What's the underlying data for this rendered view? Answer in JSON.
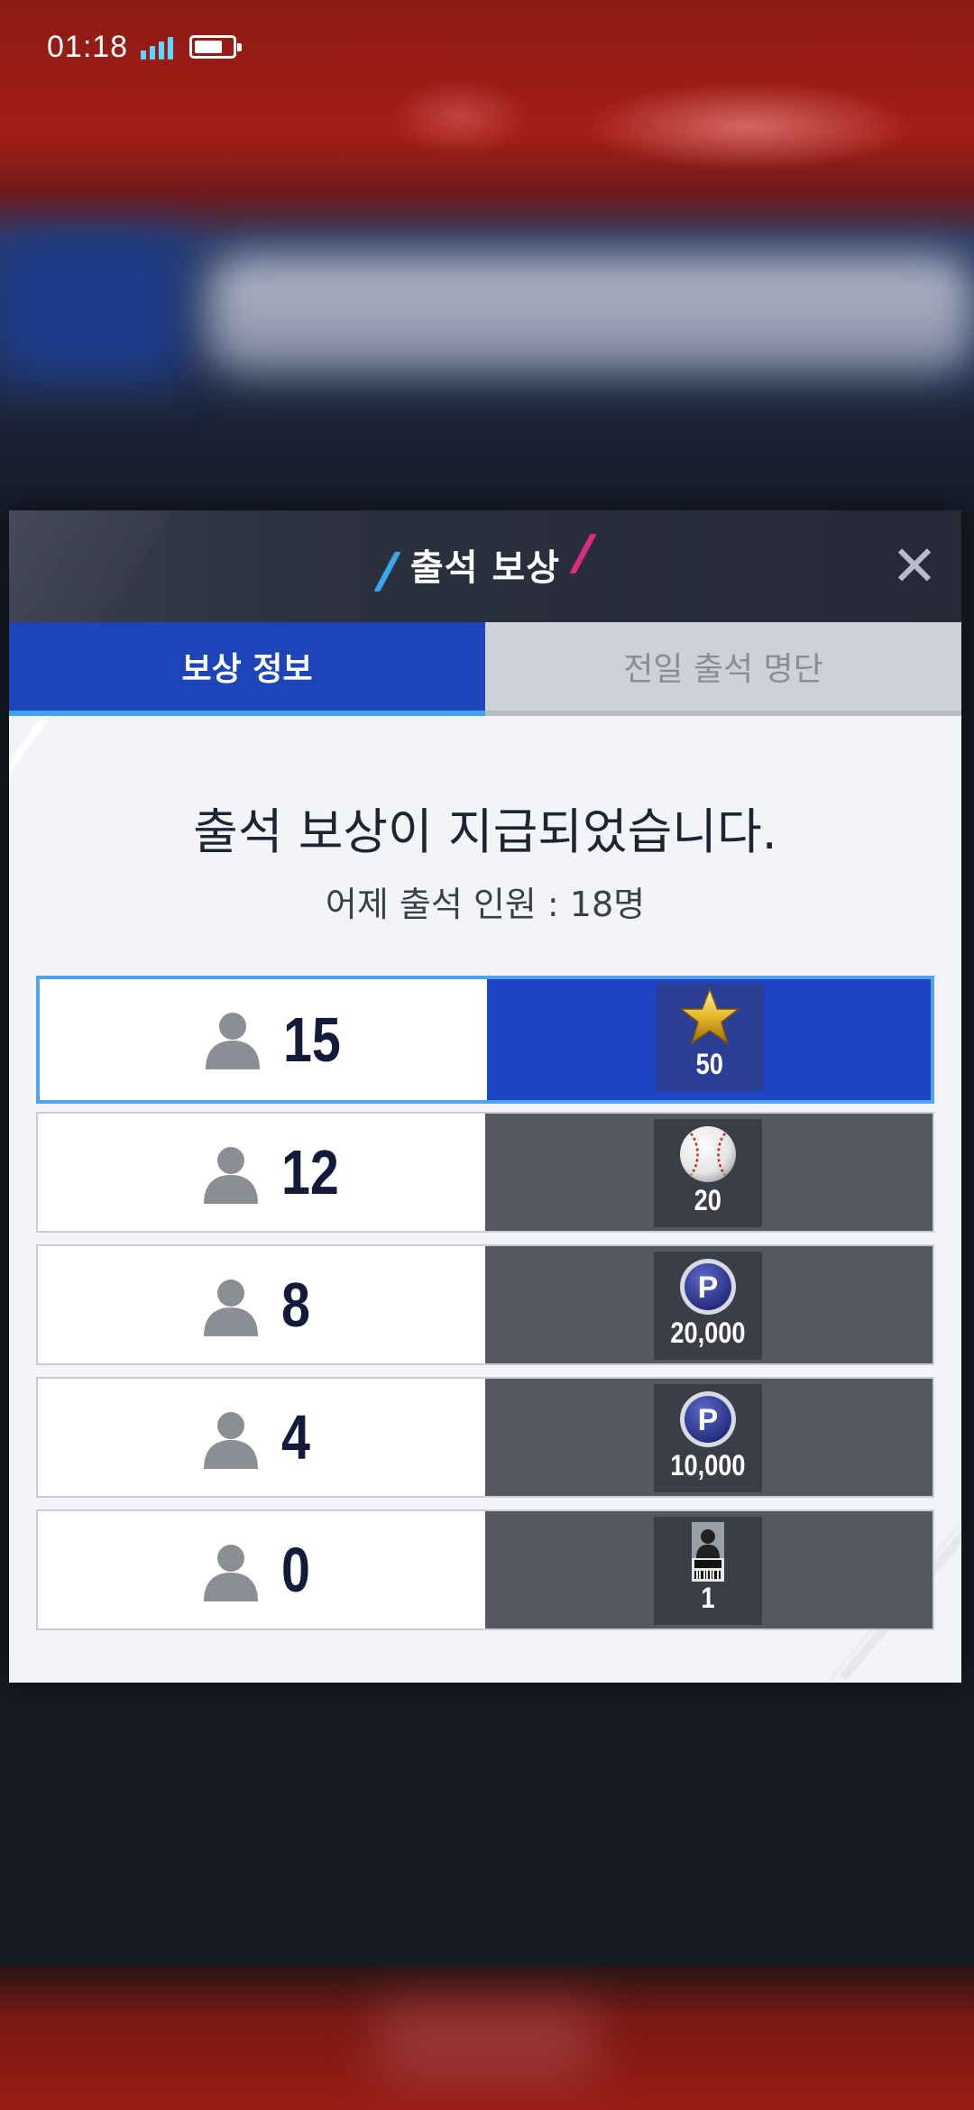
{
  "status_bar": {
    "time": "01:18"
  },
  "modal": {
    "title": "출석 보상",
    "close_icon": "close-icon",
    "tabs": [
      {
        "label": "보상 정보",
        "active": true
      },
      {
        "label": "전일 출석 명단",
        "active": false
      }
    ],
    "headline": "출석 보상이 지급되었습니다.",
    "subline": "어제 출석 인원 : 18명",
    "rewards": [
      {
        "count": "15",
        "icon": "star-icon",
        "amount": "50",
        "highlighted": true
      },
      {
        "count": "12",
        "icon": "baseball-icon",
        "amount": "20",
        "highlighted": false
      },
      {
        "count": "8",
        "icon": "point-coin-icon",
        "amount": "20,000",
        "highlighted": false
      },
      {
        "count": "4",
        "icon": "point-coin-icon",
        "amount": "10,000",
        "highlighted": false
      },
      {
        "count": "0",
        "icon": "scout-ticket-icon",
        "amount": "1",
        "highlighted": false
      }
    ]
  },
  "colors": {
    "active_tab": "#1d44b8",
    "highlight_border": "#4fa3ee",
    "reward_cell": "#555860",
    "title_slash_blue": "#3aa7e8",
    "title_slash_pink": "#e02a7f"
  }
}
